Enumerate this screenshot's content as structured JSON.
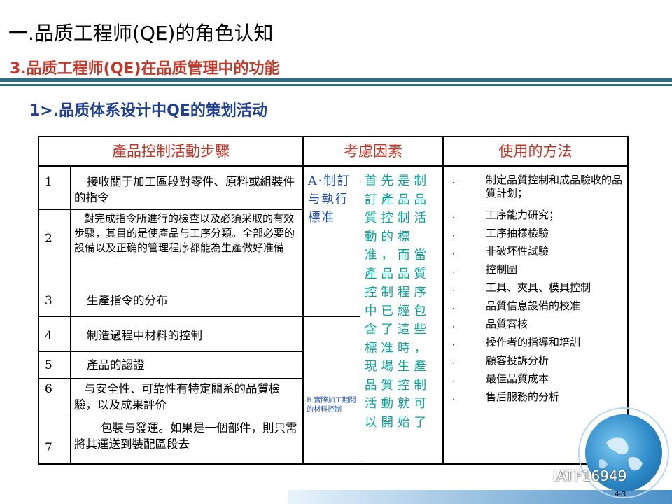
{
  "header": {
    "title": "一.品质工程师(QE)的角色认知",
    "subtitle": "3.品质工程师(QE)在品质管理中的功能",
    "section": "1>.品质体系设计中QE的策划活动"
  },
  "colors": {
    "subtitle": "#c0392b",
    "section": "#1f3f8f",
    "header_text": "#c0392b",
    "factor_a": "#1f4fb0",
    "factor_main": "#0aa39a",
    "bars": "#2e6e82"
  },
  "table": {
    "headers": [
      "產品控制活動步驟",
      "考慮因素",
      "使用的方法"
    ],
    "rows": [
      {
        "num": "1",
        "text": "接收關于加工區段對零件、原料或組裝件的指令"
      },
      {
        "num": "2",
        "text": "對完成指令所進行的檢查以及必須采取的有效步驟，其目的是使產品与工序分類。全部必要的設備以及正确的管理程序都能為生產做好准備"
      },
      {
        "num": "3",
        "text": "生產指令的分布"
      },
      {
        "num": "4",
        "text": "制造過程中材料的控制"
      },
      {
        "num": "5",
        "text": "產品的認證"
      },
      {
        "num": "6",
        "text": "与安全性、可靠性有特定關系的品質檢驗，以及成果評价"
      },
      {
        "num": "7",
        "text": "包裝与發運。如果是一個部件，則只需將其運送到裝配區段去"
      }
    ],
    "factor_a": "A·制訂与執行標准",
    "factor_b": "B·實際加工期間的材料控制",
    "factor_main": "首先是制訂產品品質控制活動的標准，而當產品品質控制程序中已經包含了這些標准時，現場生產品質控制活動就可以開始了",
    "method_dot": "·",
    "methods": [
      "制定品質控制和成品驗收的品質計划；",
      "工序能力研究；",
      "工序抽樣檢驗",
      "非破坏性試驗",
      "控制圖",
      "工具、夾具、模具控制",
      "品質信息設備的校准",
      "品質審核",
      "操作者的指導和培訓",
      "顧客投訴分析",
      "最佳品質成本",
      "售后服務的分析"
    ]
  },
  "footer": {
    "watermark": "IATF16949",
    "page": "4-3",
    "watermark_icon": "wechat-icon"
  }
}
